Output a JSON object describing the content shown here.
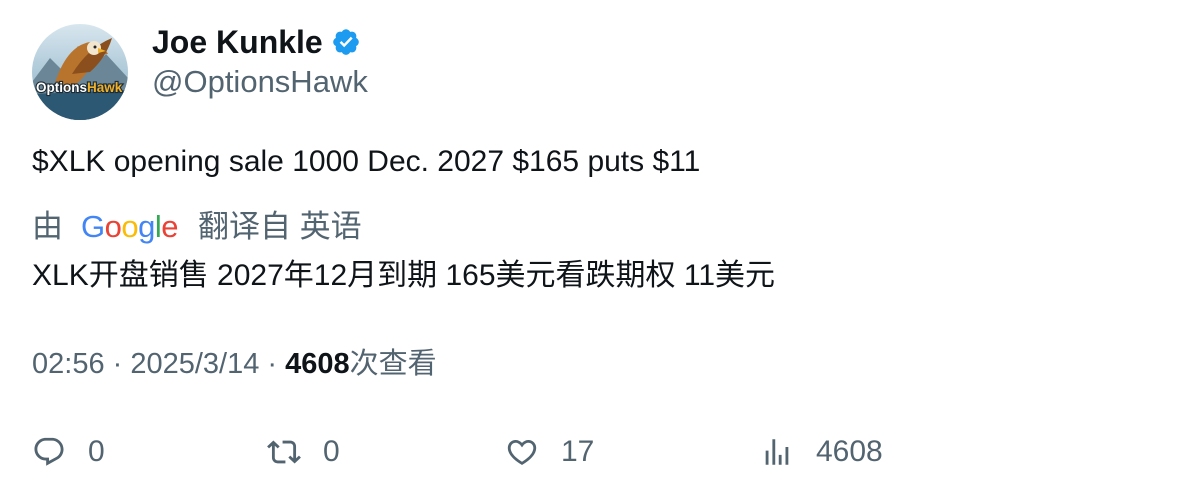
{
  "author": {
    "display_name": "Joe Kunkle",
    "handle": "@OptionsHawk",
    "verified_icon": "verified-badge-icon",
    "avatar_logo_text": "OptionsHawk"
  },
  "tweet": {
    "text": "$XLK opening sale 1000 Dec. 2027 $165 puts $11"
  },
  "translation": {
    "by_label": "由",
    "provider": "Google",
    "from_label": "翻译自 英语",
    "text": "XLK开盘销售 2027年12月到期 165美元看跌期权 11美元"
  },
  "meta": {
    "time": "02:56",
    "separator": " · ",
    "date": "2025/3/14",
    "views_count": "4608",
    "views_label": "次查看"
  },
  "actions": {
    "reply": {
      "icon": "reply-icon",
      "count": "0"
    },
    "retweet": {
      "icon": "retweet-icon",
      "count": "0"
    },
    "like": {
      "icon": "heart-icon",
      "count": "17"
    },
    "views": {
      "icon": "analytics-icon",
      "count": "4608"
    }
  },
  "colors": {
    "text_primary": "#0f1419",
    "text_secondary": "#536471",
    "verified": "#1d9bf0"
  }
}
